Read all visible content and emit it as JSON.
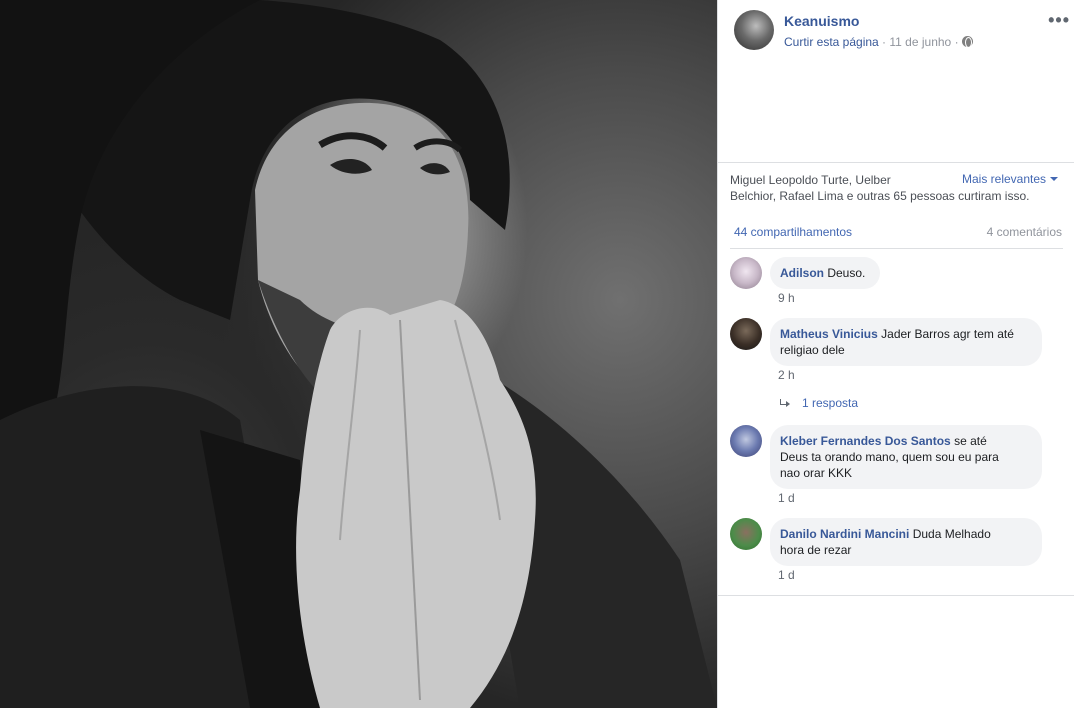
{
  "post": {
    "page_name": "Keanuismo",
    "like_page": "Curtir esta página",
    "separator1": " · ",
    "date": "11 de junho",
    "separator2": " · ",
    "more_icon": "more-options-icon",
    "privacy_icon": "globe-icon"
  },
  "reactions": {
    "likers_line1": "Miguel Leopoldo Turte, Uelber",
    "likers_line2": "Belchior, Rafael Lima e outras 65 pessoas curtiram isso.",
    "sort_label": "Mais relevantes",
    "shares": "44 compartilhamentos",
    "comments": "4 comentários"
  },
  "comments": [
    {
      "author": "Adilson",
      "text": "Deuso.",
      "time": "9 h"
    },
    {
      "author": "Matheus Vinicius",
      "text_line1": "Jader Barros agr tem até",
      "text_line2": "religiao dele",
      "time": "2 h",
      "replies": "1 resposta"
    },
    {
      "author": "Kleber Fernandes Dos Santos",
      "text_line1": "se até",
      "text_line2": "Deus ta orando mano, quem sou eu para",
      "text_line3": "nao orar KKK",
      "time": "1 d"
    },
    {
      "author": "Danilo Nardini Mancini",
      "text_line1": "Duda Melhado",
      "text_line2": "hora de rezar",
      "time": "1 d"
    }
  ],
  "colors": {
    "link_blue": "#385898",
    "accent_blue": "#4267b2",
    "bubble_gray": "#f2f3f5",
    "meta_gray": "#90949c"
  }
}
